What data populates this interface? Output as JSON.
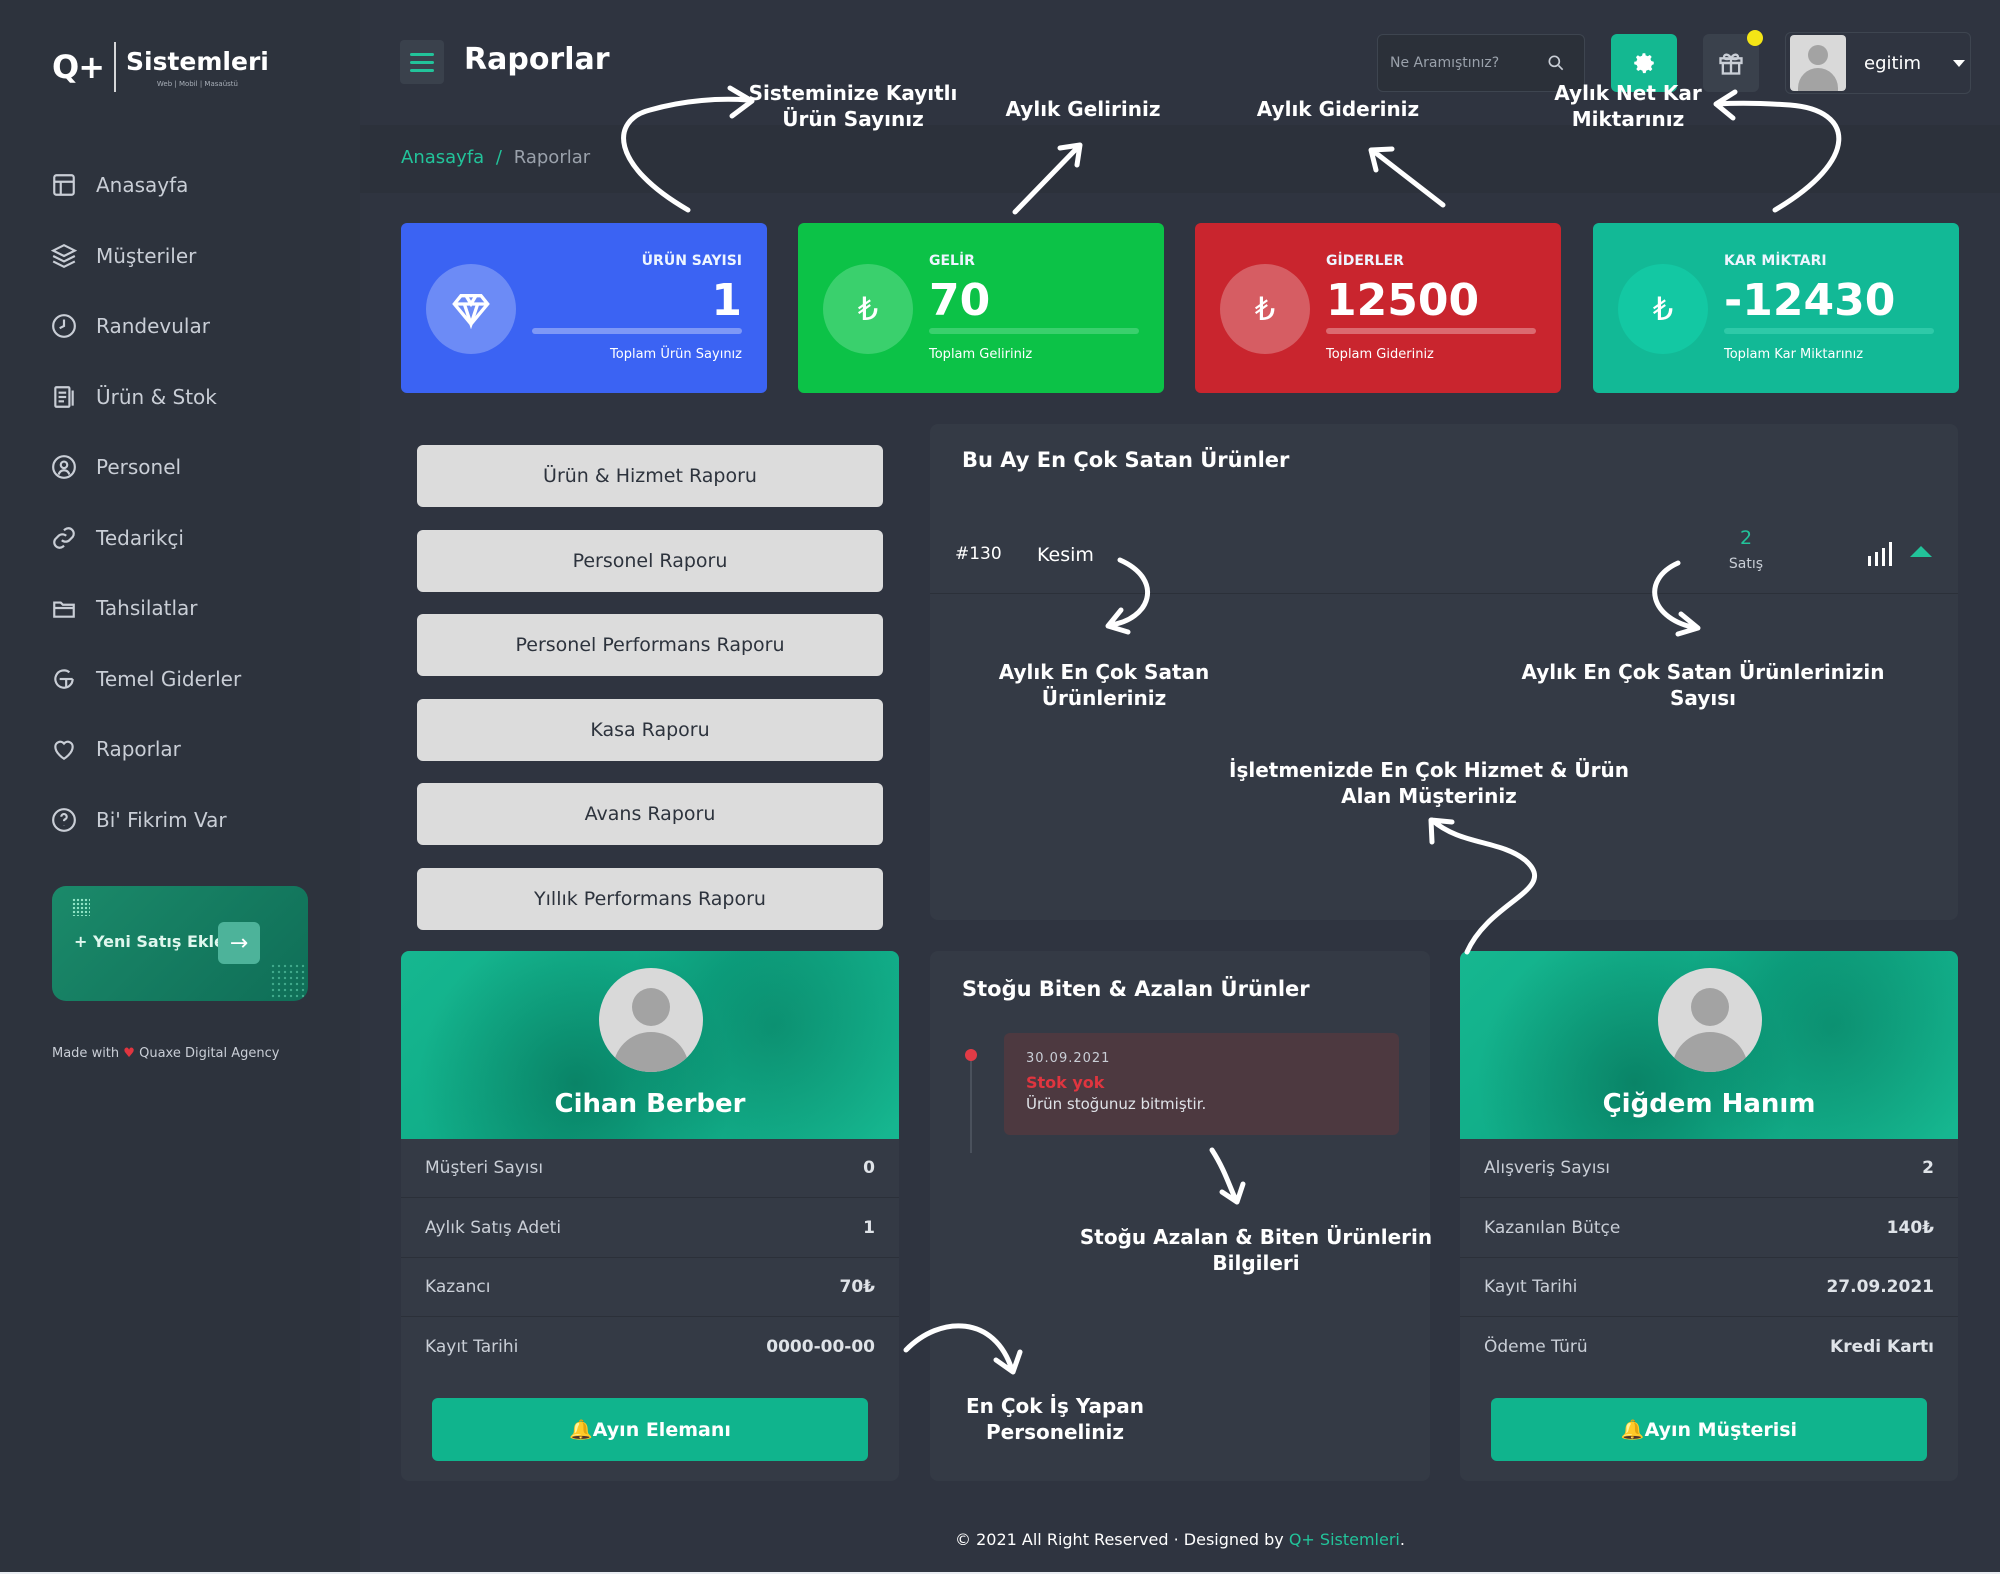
{
  "logo": {
    "mark": "Q+",
    "name": "Sistemleri",
    "tagline": "Web | Mobil | Masaüstü"
  },
  "sidebar": {
    "items": [
      {
        "label": "Anasayfa",
        "icon": "dashboard-icon"
      },
      {
        "label": "Müşteriler",
        "icon": "layers-icon"
      },
      {
        "label": "Randevular",
        "icon": "clock-icon"
      },
      {
        "label": "Ürün & Stok",
        "icon": "receipt-icon"
      },
      {
        "label": "Personel",
        "icon": "person-icon"
      },
      {
        "label": "Tedarikçi",
        "icon": "link-icon"
      },
      {
        "label": "Tahsilatlar",
        "icon": "folder-icon"
      },
      {
        "label": "Temel Giderler",
        "icon": "expense-icon"
      },
      {
        "label": "Raporlar",
        "icon": "heart-icon"
      },
      {
        "label": "Bi' Fikrim Var",
        "icon": "help-icon"
      }
    ],
    "promo_label": "+ Yeni Satış Ekle",
    "promo_arrow": "→",
    "made_prefix": "Made with",
    "made_heart": "♥",
    "made_suffix": "Quaxe Digital Agency"
  },
  "header": {
    "title": "Raporlar",
    "search_placeholder": "Ne Aramıştınız?",
    "user_name": "egitim",
    "accent": "#14b891",
    "notification_color": "#f4e516"
  },
  "breadcrumb": {
    "home": "Anasayfa",
    "separator": "/",
    "current": "Raporlar"
  },
  "annotations": {
    "product_count": "Sisteminize Kayıtlı\nÜrün Sayınız",
    "income": "Aylık Geliriniz",
    "expense": "Aylık Gideriniz",
    "profit": "Aylık Net Kar\nMiktarınız",
    "best_sellers": "Aylık En Çok Satan Ürünleriniz",
    "best_sellers_count": "Aylık En Çok Satan Ürünlerinizin Sayısı",
    "top_customer": "İşletmenizde En Çok Hizmet & Ürün\nAlan Müşteriniz",
    "stock_info": "Stoğu Azalan & Biten Ürünlerin\nBilgileri",
    "top_staff": "En Çok İş Yapan Personeliniz"
  },
  "stats": [
    {
      "label": "ÜRÜN SAYISI",
      "value": "1",
      "sub": "Toplam Ürün Sayınız",
      "color": "#3b63f3",
      "icon": "diamond-icon"
    },
    {
      "label": "GELİR",
      "value": "70",
      "sub": "Toplam Geliriniz",
      "color": "#0cc247",
      "icon": "lira-icon",
      "symbol": "₺"
    },
    {
      "label": "GİDERLER",
      "value": "12500",
      "sub": "Toplam Gideriniz",
      "color": "#c9252e",
      "icon": "lira-icon",
      "symbol": "₺"
    },
    {
      "label": "KAR MİKTARI",
      "value": "-12430",
      "sub": "Toplam Kar Miktarınız",
      "color": "#12b996",
      "icon": "lira-icon",
      "symbol": "₺"
    }
  ],
  "reports": [
    "Ürün & Hizmet Raporu",
    "Personel Raporu",
    "Personel Performans Raporu",
    "Kasa Raporu",
    "Avans Raporu",
    "Yıllık Performans Raporu"
  ],
  "best_sellers": {
    "title": "Bu Ay En Çok Satan Ürünler",
    "items": [
      {
        "id": "#130",
        "name": "Kesim",
        "count": "2",
        "count_label": "Satış"
      }
    ]
  },
  "stock": {
    "title": "Stoğu Biten & Azalan Ürünler",
    "items": [
      {
        "date": "30.09.2021",
        "status": "Stok yok",
        "message": "Ürün stoğunuz bitmiştir."
      }
    ]
  },
  "staff_card": {
    "name": "Cihan Berber",
    "rows": [
      {
        "k": "Müşteri Sayısı",
        "v": "0"
      },
      {
        "k": "Aylık Satış Adeti",
        "v": "1"
      },
      {
        "k": "Kazancı",
        "v": "70₺"
      },
      {
        "k": "Kayıt Tarihi",
        "v": "0000-00-00"
      }
    ],
    "button": "🔔Ayın Elemanı"
  },
  "customer_card": {
    "name": "Çiğdem Hanım",
    "rows": [
      {
        "k": "Alışveriş Sayısı",
        "v": "2"
      },
      {
        "k": "Kazanılan Bütçe",
        "v": "140₺"
      },
      {
        "k": "Kayıt Tarihi",
        "v": "27.09.2021"
      },
      {
        "k": "Ödeme Türü",
        "v": "Kredi Kartı"
      }
    ],
    "button": "🔔Ayın Müşterisi"
  },
  "footer": {
    "text": "© 2021 All Right Reserved · Designed by",
    "brand": "Q+ Sistemleri",
    "end": "."
  }
}
